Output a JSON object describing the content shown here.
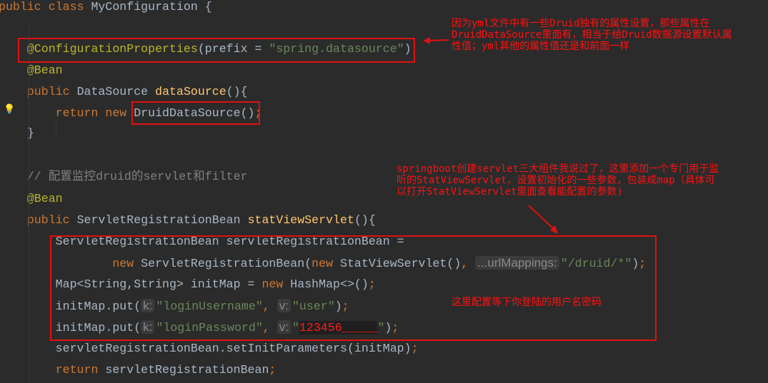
{
  "code": [
    {
      "indent": 0,
      "tokens": [
        [
          "kw",
          "public class "
        ],
        [
          "pl",
          "MyConfiguration {"
        ]
      ]
    },
    {
      "indent": 4,
      "tokens": []
    },
    {
      "indent": 4,
      "tokens": [
        [
          "ann",
          "@ConfigurationProperties"
        ],
        [
          "pl",
          "(prefix = "
        ],
        [
          "str",
          "\"spring.datasource\""
        ],
        [
          "pl",
          ")"
        ]
      ]
    },
    {
      "indent": 4,
      "tokens": [
        [
          "ann",
          "@Bean"
        ]
      ]
    },
    {
      "indent": 4,
      "tokens": [
        [
          "kw",
          "public "
        ],
        [
          "pl",
          "DataSource "
        ],
        [
          "fn",
          "dataSource"
        ],
        [
          "pl",
          "(){"
        ]
      ]
    },
    {
      "indent": 8,
      "tokens": [
        [
          "kw",
          "return new "
        ],
        [
          "pl",
          "DruidDataSource()"
        ],
        [
          "kw",
          ";"
        ]
      ]
    },
    {
      "indent": 4,
      "tokens": [
        [
          "pl",
          "}"
        ]
      ]
    },
    {
      "indent": 4,
      "tokens": []
    },
    {
      "indent": 4,
      "tokens": [
        [
          "cm",
          "// 配置监控druid的servlet和filter"
        ]
      ]
    },
    {
      "indent": 4,
      "tokens": [
        [
          "ann",
          "@Bean"
        ]
      ]
    },
    {
      "indent": 4,
      "tokens": [
        [
          "kw",
          "public "
        ],
        [
          "pl",
          "ServletRegistrationBean "
        ],
        [
          "fn",
          "statViewServlet"
        ],
        [
          "pl",
          "(){"
        ]
      ]
    },
    {
      "indent": 8,
      "tokens": [
        [
          "pl",
          "ServletRegistrationBean servletRegistrationBean ="
        ]
      ]
    },
    {
      "indent": 16,
      "tokens": [
        [
          "kw",
          "new "
        ],
        [
          "pl",
          "ServletRegistrationBean("
        ],
        [
          "kw",
          "new "
        ],
        [
          "pl",
          "StatViewServlet()"
        ],
        [
          "kw",
          ", "
        ],
        [
          "hint",
          "...urlMappings:"
        ],
        [
          "str",
          "\"/druid/*\""
        ],
        [
          "pl",
          ")"
        ],
        [
          "kw",
          ";"
        ]
      ]
    },
    {
      "indent": 8,
      "tokens": [
        [
          "pl",
          "Map<String,String> initMap = "
        ],
        [
          "kw",
          "new "
        ],
        [
          "pl",
          "HashMap<>()"
        ],
        [
          "kw",
          ";"
        ]
      ]
    },
    {
      "indent": 8,
      "tokens": [
        [
          "pl",
          "initMap.put("
        ],
        [
          "hint",
          "k:"
        ],
        [
          "str",
          "\"loginUsername\""
        ],
        [
          "kw",
          ", "
        ],
        [
          "hint",
          "v:"
        ],
        [
          "str",
          "\"user\""
        ],
        [
          "pl",
          ")"
        ],
        [
          "kw",
          ";"
        ]
      ]
    },
    {
      "indent": 8,
      "tokens": [
        [
          "pl",
          "initMap.put("
        ],
        [
          "hint",
          "k:"
        ],
        [
          "str",
          "\"loginPassword\""
        ],
        [
          "kw",
          ", "
        ],
        [
          "hint",
          "v:"
        ],
        [
          "str",
          "\""
        ],
        [
          "hl",
          "123456_____"
        ],
        [
          "str",
          "\""
        ],
        [
          "pl",
          ")"
        ],
        [
          "kw",
          ";"
        ]
      ]
    },
    {
      "indent": 8,
      "tokens": [
        [
          "pl",
          "servletRegistrationBean.setInitParameters(initMap)"
        ],
        [
          "kw",
          ";"
        ]
      ]
    },
    {
      "indent": 8,
      "tokens": [
        [
          "kw",
          "return "
        ],
        [
          "pl",
          "servletRegistrationBean"
        ],
        [
          "kw",
          ";"
        ]
      ]
    }
  ],
  "notes": {
    "note1": "因为yml文件中有一些Druid独有的属性设置，那些属性在\nDruidDataSource里面有，相当于给Druid数据源设置默认属\n性值；yml其他的属性值还是和前面一样",
    "note2": "springboot创建servlet三大组件我说过了，这里添加一个专门用于监\n听的StatViewServlet，设置初始化的一些参数，包装成map（具体可\n以打开StatViewServlet里面查看能配置的参数)",
    "note3": "这里配置等下你登陆的用户名密码"
  },
  "colors": {
    "annotation_red": "#e01010",
    "background": "#2b2b2b"
  }
}
